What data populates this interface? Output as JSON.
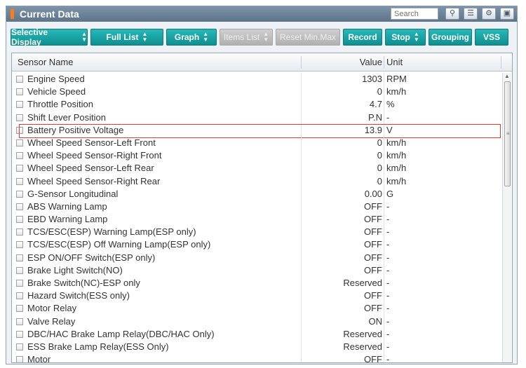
{
  "window": {
    "title": "Current Data"
  },
  "search": {
    "placeholder": "Search"
  },
  "toolbar_buttons": {
    "selective_display": "Selective Display",
    "full_list": "Full List",
    "graph": "Graph",
    "items_list": "Items List",
    "reset_min_max": "Reset Min.Max",
    "record": "Record",
    "stop": "Stop",
    "grouping": "Grouping",
    "vss": "VSS"
  },
  "grid": {
    "headers": {
      "name": "Sensor Name",
      "value": "Value",
      "unit": "Unit"
    },
    "rows": [
      {
        "name": "Engine Speed",
        "value": "1303",
        "unit": "RPM"
      },
      {
        "name": "Vehicle Speed",
        "value": "0",
        "unit": "km/h"
      },
      {
        "name": "Throttle Position",
        "value": "4.7",
        "unit": "%"
      },
      {
        "name": "Shift Lever Position",
        "value": "P.N",
        "unit": "-"
      },
      {
        "name": "Battery Positive Voltage",
        "value": "13.9",
        "unit": "V"
      },
      {
        "name": "Wheel Speed Sensor-Left Front",
        "value": "0",
        "unit": "km/h"
      },
      {
        "name": "Wheel Speed Sensor-Right Front",
        "value": "0",
        "unit": "km/h"
      },
      {
        "name": "Wheel Speed Sensor-Left Rear",
        "value": "0",
        "unit": "km/h"
      },
      {
        "name": "Wheel Speed Sensor-Right Rear",
        "value": "0",
        "unit": "km/h"
      },
      {
        "name": "G-Sensor Longitudinal",
        "value": "0.00",
        "unit": "G"
      },
      {
        "name": "ABS Warning Lamp",
        "value": "OFF",
        "unit": "-"
      },
      {
        "name": "EBD Warning Lamp",
        "value": "OFF",
        "unit": "-"
      },
      {
        "name": "TCS/ESC(ESP) Warning Lamp(ESP only)",
        "value": "OFF",
        "unit": "-"
      },
      {
        "name": "TCS/ESC(ESP) Off Warning Lamp(ESP only)",
        "value": "OFF",
        "unit": "-"
      },
      {
        "name": "ESP ON/OFF Switch(ESP only)",
        "value": "OFF",
        "unit": "-"
      },
      {
        "name": "Brake Light Switch(NO)",
        "value": "OFF",
        "unit": "-"
      },
      {
        "name": "Brake Switch(NC)-ESP only",
        "value": "Reserved",
        "unit": "-"
      },
      {
        "name": "Hazard Switch(ESS only)",
        "value": "OFF",
        "unit": "-"
      },
      {
        "name": "Motor Relay",
        "value": "OFF",
        "unit": "-"
      },
      {
        "name": "Valve Relay",
        "value": "ON",
        "unit": "-"
      },
      {
        "name": "DBC/HAC Brake Lamp Relay(DBC/HAC Only)",
        "value": "Reserved",
        "unit": "-"
      },
      {
        "name": "ESS Brake Lamp Relay(ESS Only)",
        "value": "Reserved",
        "unit": "-"
      },
      {
        "name": "Motor",
        "value": "OFF",
        "unit": "-"
      }
    ]
  },
  "colors": {
    "button_teal": "#1aa3a4",
    "titlebar": "#6b8196",
    "title_accent": "#ff7a1a",
    "selection_border": "#e63a3a"
  },
  "icons": [
    "search-icon",
    "list-icon",
    "settings-icon",
    "window-icon",
    "spinner-icon",
    "scroll-grip-icon"
  ]
}
